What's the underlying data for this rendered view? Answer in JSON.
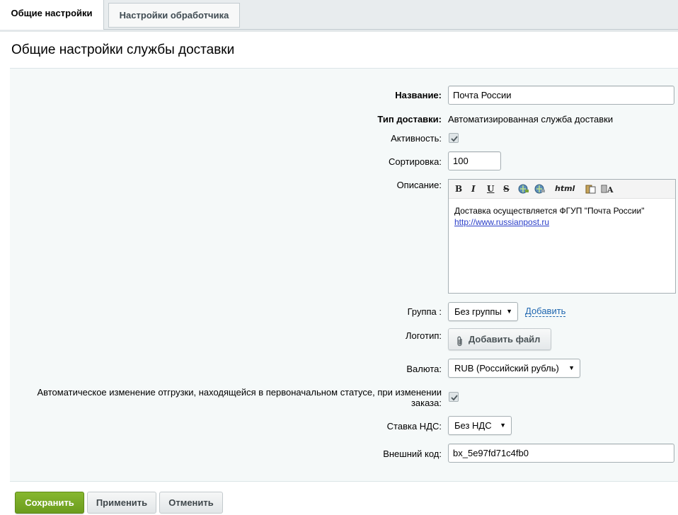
{
  "tabs": {
    "general": "Общие настройки",
    "handler": "Настройки обработчика"
  },
  "page_title": "Общие настройки службы доставки",
  "form": {
    "name_label": "Название:",
    "name_value": "Почта России",
    "type_label": "Тип доставки:",
    "type_value": "Автоматизированная служба доставки",
    "active_label": "Активность:",
    "active_checked": true,
    "sort_label": "Сортировка:",
    "sort_value": "100",
    "description_label": "Описание:",
    "description_text": "Доставка осуществляется ФГУП \"Почта России\"",
    "description_link": "http://www.russianpost.ru",
    "toolbar": {
      "bold": "B",
      "italic": "I",
      "underline": "U",
      "strike": "S",
      "html": "html"
    },
    "group_label": "Группа :",
    "group_value": "Без группы",
    "group_add_link": "Добавить",
    "logo_label": "Логотип:",
    "logo_button": "Добавить файл",
    "currency_label": "Валюта:",
    "currency_value": "RUB (Российский рубль)",
    "auto_change_label_line1": "Автоматическое изменение отгрузки, находящейся в первоначальном статусе, при изменении",
    "auto_change_label_line2": "заказа:",
    "auto_change_checked": true,
    "vat_label": "Ставка НДС:",
    "vat_value": "Без НДС",
    "external_code_label": "Внешний код:",
    "external_code_value": "bx_5e97fd71c4fb0"
  },
  "buttons": {
    "save": "Сохранить",
    "apply": "Применить",
    "cancel": "Отменить"
  },
  "colors": {
    "save_button": "#78a826",
    "link": "#2067b0"
  }
}
